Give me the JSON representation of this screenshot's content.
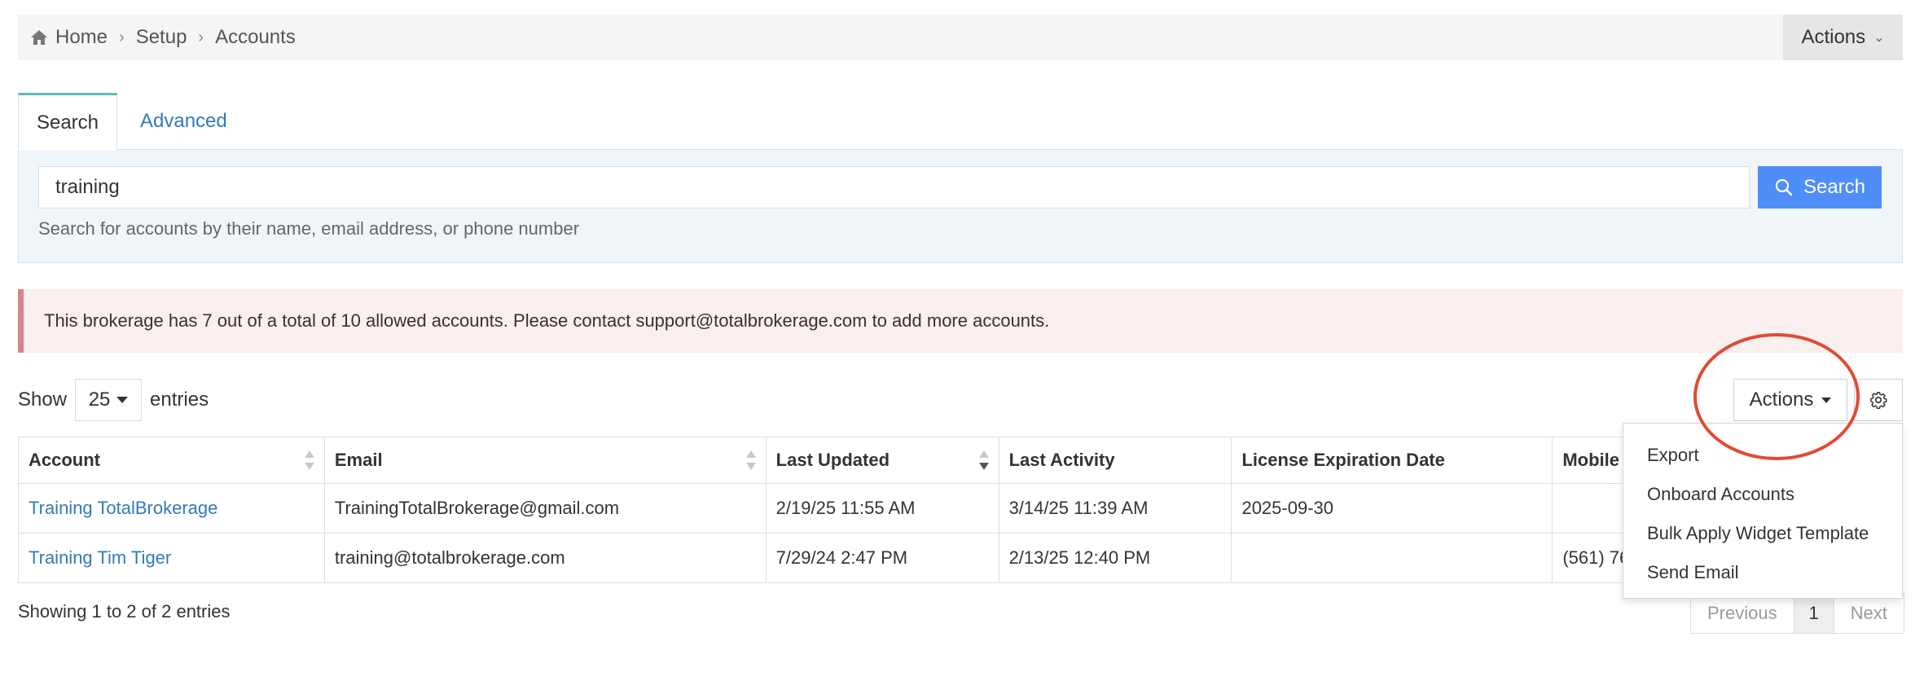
{
  "breadcrumb": {
    "items": [
      "Home",
      "Setup",
      "Accounts"
    ],
    "actions_label": "Actions"
  },
  "tabs": [
    {
      "label": "Search",
      "active": true
    },
    {
      "label": "Advanced",
      "active": false
    }
  ],
  "search": {
    "value": "training",
    "button_label": "Search",
    "help": "Search for accounts by their name, email address, or phone number"
  },
  "alert": {
    "text": "This brokerage has 7 out of a total of 10 allowed accounts. Please contact support@totalbrokerage.com to add more accounts."
  },
  "entries": {
    "show_label": "Show",
    "count": "25",
    "suffix": "entries"
  },
  "actions": {
    "label": "Actions",
    "menu": [
      "Export",
      "Onboard Accounts",
      "Bulk Apply Widget Template",
      "Send Email"
    ]
  },
  "table": {
    "headers": [
      "Account",
      "Email",
      "Last Updated",
      "Last Activity",
      "License Expiration Date",
      "Mobile"
    ],
    "rows": [
      [
        "Training TotalBrokerage",
        "TrainingTotalBrokerage@gmail.com",
        "2/19/25 11:55 AM",
        "3/14/25 11:39 AM",
        "2025-09-30",
        ""
      ],
      [
        "Training Tim Tiger",
        "training@totalbrokerage.com",
        "7/29/24 2:47 PM",
        "2/13/25 12:40 PM",
        "",
        "(561) 76"
      ]
    ]
  },
  "info": "Showing 1 to 2 of 2 entries",
  "pagination": {
    "previous": "Previous",
    "current": "1",
    "next": "Next"
  },
  "colors": {
    "link": "#337ab7",
    "primary": "#4f8ef7",
    "tab_accent": "#5bbcb5",
    "alert_bg": "#f8efee",
    "alert_border": "#d9838e",
    "highlight": "#e24a33"
  }
}
